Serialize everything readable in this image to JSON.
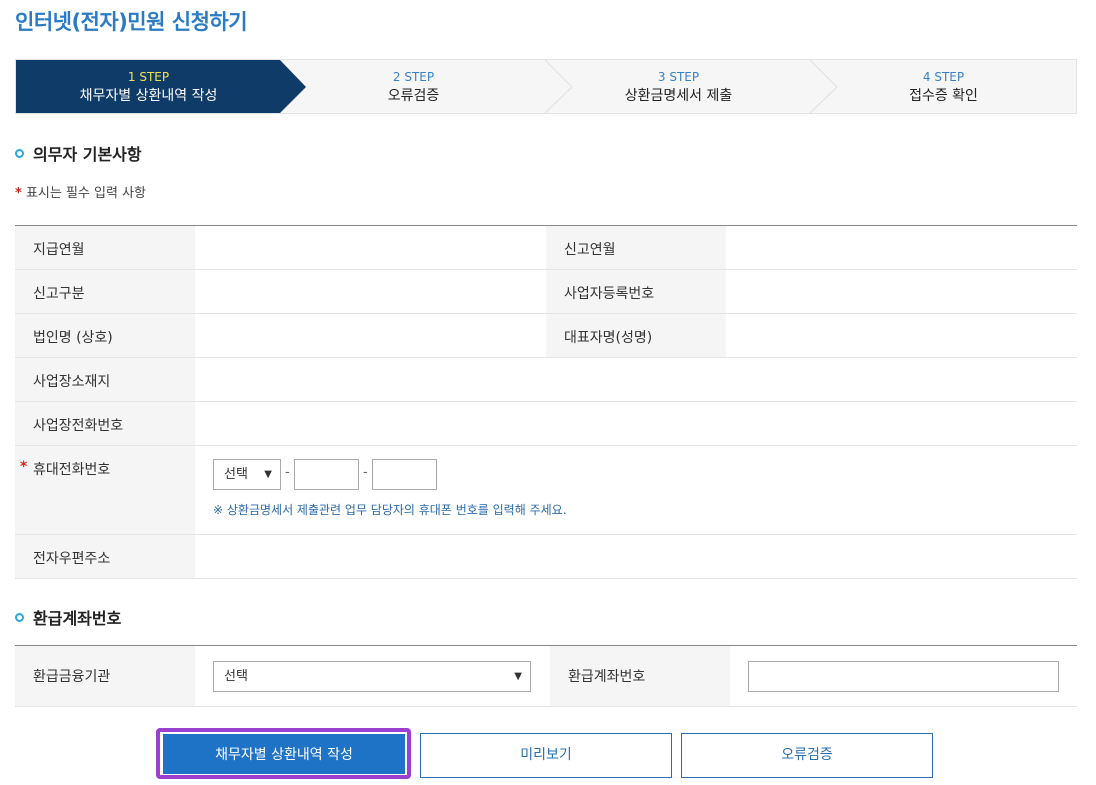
{
  "page_title": "인터넷(전자)민원 신청하기",
  "steps": [
    {
      "num": "1 STEP",
      "label": "채무자별 상환내역 작성",
      "active": true
    },
    {
      "num": "2 STEP",
      "label": "오류검증",
      "active": false
    },
    {
      "num": "3 STEP",
      "label": "상환금명세서 제출",
      "active": false
    },
    {
      "num": "4 STEP",
      "label": "접수증 확인",
      "active": false
    }
  ],
  "colors": {
    "active_step": "#0f3b68",
    "accent": "#1f73c7",
    "focus": "#9b3fd1",
    "required": "#d0251f"
  },
  "section1": {
    "title": "의무자 기본사항",
    "required_note": "표시는 필수 입력 사항",
    "rows": {
      "pay_month": "지급연월",
      "report_month": "신고연월",
      "report_type": "신고구분",
      "biz_no": "사업자등록번호",
      "corp_name": "법인명 (상호)",
      "rep_name": "대표자명(성명)",
      "address": "사업장소재지",
      "phone": "사업장전화번호",
      "mobile": "휴대전화번호",
      "email": "전자우편주소"
    },
    "mobile_select": "선택",
    "mobile_hint": "※ 상환금명세서 제출관련 업무 담당자의 휴대폰 번호를 입력해 주세요."
  },
  "section2": {
    "title": "환급계좌번호",
    "bank_label": "환급금융기관",
    "bank_select": "선택",
    "account_label": "환급계좌번호"
  },
  "buttons": {
    "write": "채무자별 상환내역 작성",
    "preview": "미리보기",
    "validate": "오류검증"
  }
}
